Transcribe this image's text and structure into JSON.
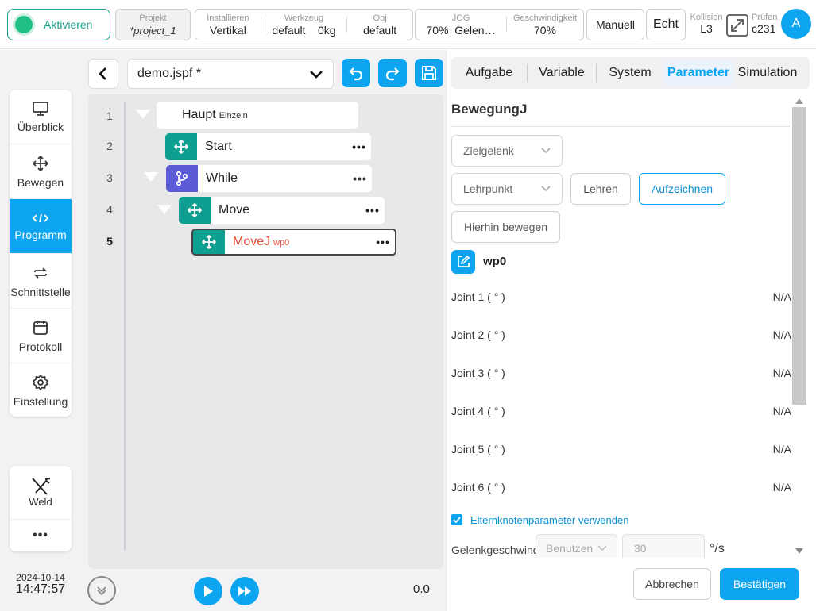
{
  "topbar": {
    "activate_label": "Aktivieren",
    "project": {
      "label": "Projekt",
      "value": "*project_1"
    },
    "install": {
      "label": "Installieren",
      "value": "Vertikal"
    },
    "tool": {
      "label": "Werkzeug",
      "value": "default",
      "extra": "0kg"
    },
    "obj": {
      "label": "Obj",
      "value": "default"
    },
    "jog": {
      "label": "JOG",
      "value": "70%",
      "extra": "Gelen…"
    },
    "speed": {
      "label": "Geschwindigkeit",
      "value": "70%"
    },
    "manual_label": "Manuell",
    "real_label": "Echt",
    "collision": {
      "label": "Kollision",
      "value": "L3"
    },
    "check": {
      "label": "Prüfen",
      "value": "c231"
    },
    "avatar_letter": "A",
    "accent": "#0ea5f0"
  },
  "nav": {
    "items": [
      {
        "label": "Überblick",
        "icon": "monitor-icon"
      },
      {
        "label": "Bewegen",
        "icon": "move-icon"
      },
      {
        "label": "Programm",
        "icon": "code-icon",
        "active": true
      },
      {
        "label": "Schnittstelle",
        "icon": "swap-icon"
      },
      {
        "label": "Protokoll",
        "icon": "calendar-icon"
      },
      {
        "label": "Einstellung",
        "icon": "gear-icon"
      }
    ],
    "weld_label": "Weld",
    "more_label": "•••",
    "date": "2024-10-14",
    "time": "14:47:57"
  },
  "program": {
    "filename": "demo.jspf *",
    "lines": [
      "1",
      "2",
      "3",
      "4",
      "5"
    ],
    "nodes": [
      {
        "label": "Haupt",
        "sub": "Einzeln"
      },
      {
        "label": "Start"
      },
      {
        "label": "While"
      },
      {
        "label": "Move"
      },
      {
        "label": "MoveJ",
        "sub": "wp0"
      }
    ],
    "dots": "•••",
    "progress_value": "0.0"
  },
  "tabs": [
    "Aufgabe",
    "Variable",
    "System",
    "Parameter",
    "Simulation"
  ],
  "params": {
    "title": "BewegungJ",
    "target_select": "Zielgelenk",
    "teach_select": "Lehrpunkt",
    "teach_button": "Lehren",
    "record_button": "Aufzeichnen",
    "move_here_button": "Hierhin bewegen",
    "waypoint": "wp0",
    "joints": [
      {
        "label": "Joint 1 ( ° )",
        "value": "N/A"
      },
      {
        "label": "Joint 2 ( ° )",
        "value": "N/A"
      },
      {
        "label": "Joint 3 ( ° )",
        "value": "N/A"
      },
      {
        "label": "Joint 4 ( ° )",
        "value": "N/A"
      },
      {
        "label": "Joint 5 ( ° )",
        "value": "N/A"
      },
      {
        "label": "Joint 6 ( ° )",
        "value": "N/A"
      }
    ],
    "use_parent_label": "Elternknotenparameter verwenden",
    "joint_speed_label": "Gelenkgeschwindigkeit",
    "joint_speed_select": "Benutzen",
    "joint_speed_value": "30",
    "joint_speed_unit": "°/s"
  },
  "footer": {
    "cancel": "Abbrechen",
    "confirm": "Bestätigen"
  }
}
